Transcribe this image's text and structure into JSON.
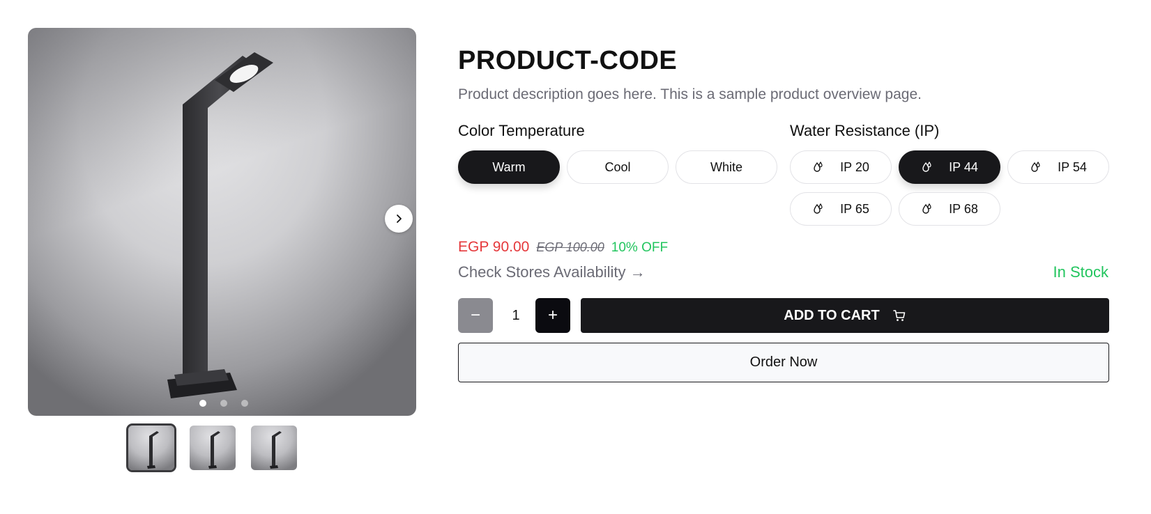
{
  "product": {
    "title": "PRODUCT-CODE",
    "description": "Product description goes here. This is a sample product overview page."
  },
  "gallery": {
    "active_index": 0,
    "image_count": 3,
    "next_icon": "chevron-right-icon"
  },
  "color_temperature": {
    "label": "Color Temperature",
    "options": [
      "Warm",
      "Cool",
      "White"
    ],
    "selected": "Warm"
  },
  "water_resistance": {
    "label": "Water Resistance (IP)",
    "options": [
      "IP 20",
      "IP 44",
      "IP 54",
      "IP 65",
      "IP 68"
    ],
    "selected": "IP 44",
    "option_icon": "water-drop-icon"
  },
  "pricing": {
    "price": "EGP 90.00",
    "old_price": "EGP 100.00",
    "discount": "10% OFF"
  },
  "availability": {
    "stores_link": "Check Stores Availability →",
    "stock_status": "In Stock"
  },
  "quantity": {
    "minus": "−",
    "value": "1",
    "plus": "+"
  },
  "actions": {
    "add_to_cart": "ADD TO CART",
    "add_to_cart_icon": "cart-icon",
    "order_now": "Order Now"
  },
  "colors": {
    "primary": "#18181b",
    "price_red": "#e5383b",
    "success_green": "#22c55e",
    "muted_text": "#6b6b75"
  }
}
